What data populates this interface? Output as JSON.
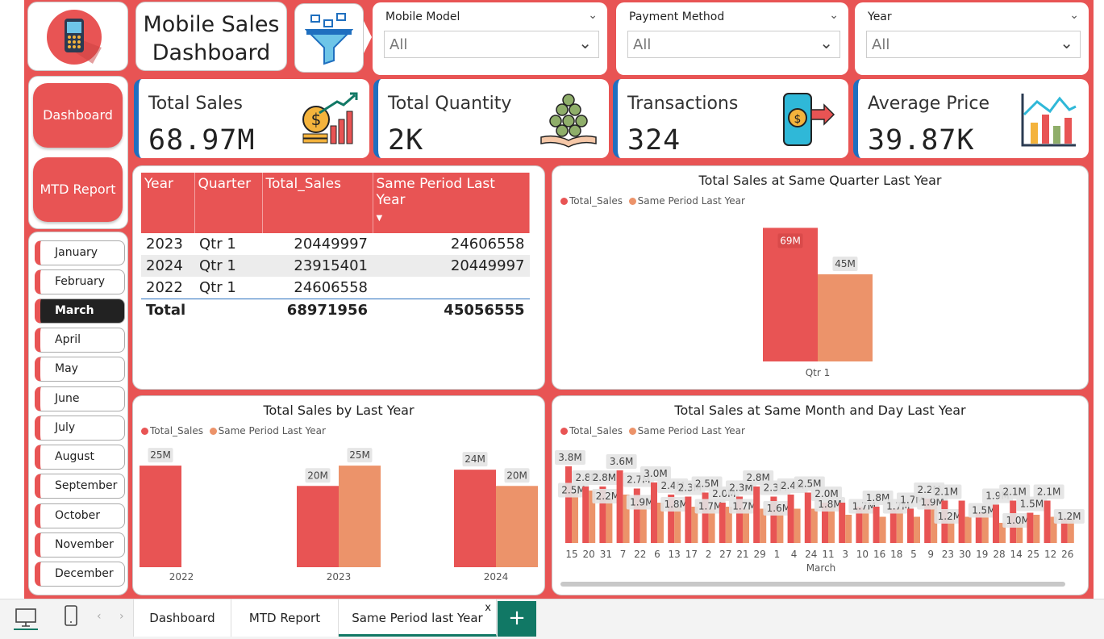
{
  "header": {
    "title_line1": "Mobile Sales",
    "title_line2": "Dashboard"
  },
  "slicers": [
    {
      "label": "Mobile Model",
      "value": "All"
    },
    {
      "label": "Payment Method",
      "value": "All"
    },
    {
      "label": "Year",
      "value": "All"
    }
  ],
  "nav": {
    "dashboard": "Dashboard",
    "mtd": "MTD Report"
  },
  "months": [
    "January",
    "February",
    "March",
    "April",
    "May",
    "June",
    "July",
    "August",
    "September",
    "October",
    "November",
    "December"
  ],
  "active_month": "March",
  "kpis": [
    {
      "label": "Total Sales",
      "value": "68.97M",
      "icon": "money-growth-icon"
    },
    {
      "label": "Total Quantity",
      "value": "2K",
      "icon": "coins-hand-icon"
    },
    {
      "label": "Transactions",
      "value": "324",
      "icon": "phone-payment-icon"
    },
    {
      "label": "Average Price",
      "value": "39.87K",
      "icon": "bar-chart-icon"
    }
  ],
  "table": {
    "headers": [
      "Year",
      "Quarter",
      "Total_Sales",
      "Same Period Last Year"
    ],
    "rows": [
      [
        "2023",
        "Qtr 1",
        "20449997",
        "24606558"
      ],
      [
        "2024",
        "Qtr 1",
        "23915401",
        "20449997"
      ],
      [
        "2022",
        "Qtr 1",
        "24606558",
        ""
      ]
    ],
    "total": [
      "Total",
      "",
      "68971956",
      "45056555"
    ]
  },
  "colors": {
    "total_sales": "#e85454",
    "same_period": "#ec936a",
    "accent": "#117865"
  },
  "chart_data": [
    {
      "type": "bar",
      "title": "Total Sales at Same Quarter Last Year",
      "categories": [
        "Qtr 1"
      ],
      "series": [
        {
          "name": "Total_Sales",
          "values": [
            69
          ]
        },
        {
          "name": "Same Period Last Year",
          "values": [
            45
          ]
        }
      ],
      "data_labels": [
        [
          "69M"
        ],
        [
          "45M"
        ]
      ],
      "unit": "M",
      "legend": "top-left",
      "ylim": [
        0,
        75
      ]
    },
    {
      "type": "bar",
      "title": "Total Sales by Last Year",
      "categories": [
        "2022",
        "2023",
        "2024"
      ],
      "series": [
        {
          "name": "Total_Sales",
          "values": [
            25,
            20,
            24
          ]
        },
        {
          "name": "Same Period Last Year",
          "values": [
            null,
            25,
            20
          ]
        }
      ],
      "data_labels": [
        [
          "25M",
          "20M",
          "24M"
        ],
        [
          "",
          "25M",
          "20M"
        ]
      ],
      "unit": "M",
      "legend": "top-left",
      "ylim": [
        0,
        28
      ]
    },
    {
      "type": "bar",
      "title": "Total Sales at Same Month and Day Last Year",
      "xlabel": "March",
      "categories": [
        "15",
        "20",
        "31",
        "7",
        "22",
        "6",
        "13",
        "17",
        "2",
        "27",
        "21",
        "29",
        "1",
        "4",
        "24",
        "11",
        "3",
        "10",
        "16",
        "18",
        "5",
        "9",
        "23",
        "30",
        "19",
        "28",
        "14",
        "25",
        "12",
        "26"
      ],
      "series": [
        {
          "name": "Total_Sales",
          "values": [
            3.8,
            2.8,
            2.8,
            3.6,
            2.7,
            3.0,
            2.4,
            2.3,
            2.5,
            2.0,
            2.3,
            2.8,
            2.3,
            2.4,
            2.5,
            2.0,
            2.0,
            1.8,
            1.8,
            1.7,
            1.7,
            2.2,
            2.1,
            2.1,
            1.5,
            1.9,
            2.1,
            1.5,
            2.1,
            1.2
          ]
        },
        {
          "name": "Same Period Last Year",
          "values": [
            2.5,
            2.6,
            2.2,
            2.4,
            1.9,
            2.0,
            1.8,
            1.8,
            1.7,
            1.8,
            1.7,
            1.7,
            1.6,
            1.7,
            1.7,
            1.8,
            1.4,
            1.7,
            1.3,
            1.7,
            1.3,
            1.9,
            1.2,
            1.3,
            1.5,
            1.0,
            1.0,
            1.4,
            1.3,
            1.2
          ]
        }
      ],
      "data_labels_total": [
        "3.8M",
        "2.8M",
        "2.8M",
        "3.6M",
        "2.7M",
        "3.0M",
        "2.4M",
        "2.3M",
        "2.5M",
        "2.0M",
        "2.3M",
        "2.8M",
        "2.3M",
        "2.4M",
        "2.5M",
        "2.0M",
        "",
        "",
        "1.8M",
        "",
        "1.7M",
        "2.2M",
        "2.1M",
        "",
        "",
        "1.9M",
        "2.1M",
        "1.5M",
        "2.1M",
        ""
      ],
      "data_labels_same": [
        "2.5M",
        "",
        "2.2M",
        "",
        "1.9M",
        "",
        "1.8M",
        "",
        "1.7M",
        "",
        "1.7M",
        "",
        "1.6M",
        "",
        "",
        "1.8M",
        "",
        "1.7M",
        "",
        "1.7M",
        "",
        "1.9M",
        "1.2M",
        "",
        "1.5M",
        "",
        "1.0M",
        "",
        "",
        "1.2M"
      ],
      "unit": "M",
      "legend": "top-left",
      "ylim": [
        0,
        4
      ]
    }
  ],
  "tabs": [
    "Dashboard",
    "MTD Report",
    "Same Period last Year"
  ],
  "active_tab": "Same Period last Year"
}
